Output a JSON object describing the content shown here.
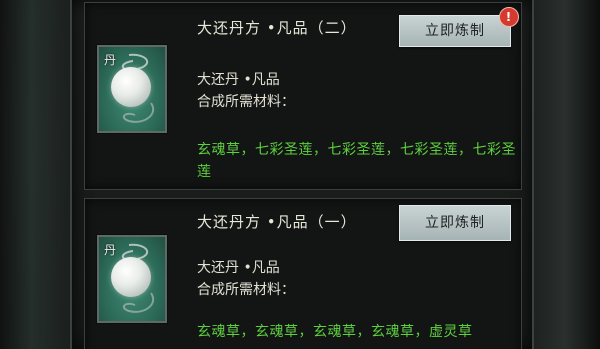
{
  "recipes": [
    {
      "title": "大还丹方 •凡品（二）",
      "button_label": "立即炼制",
      "alert": "!",
      "thumb_label": "丹",
      "product": "大还丹 •凡品",
      "materials_label": "合成所需材料：",
      "materials": "玄魂草，七彩圣莲，七彩圣莲，七彩圣莲，七彩圣莲"
    },
    {
      "title": "大还丹方 •凡品（一）",
      "button_label": "立即炼制",
      "thumb_label": "丹",
      "product": "大还丹 •凡品",
      "materials_label": "合成所需材料：",
      "materials": "玄魂草，玄魂草，玄魂草，玄魂草，虚灵草"
    }
  ],
  "colors": {
    "material_text": "#5ed03f",
    "button_bg": "#b8c4c4",
    "alert_badge": "#d43a2e",
    "thumb_bg": "#3f8a73"
  },
  "icons": {
    "pill": "white-elixir-pill-icon",
    "alert": "exclamation-badge-icon"
  }
}
